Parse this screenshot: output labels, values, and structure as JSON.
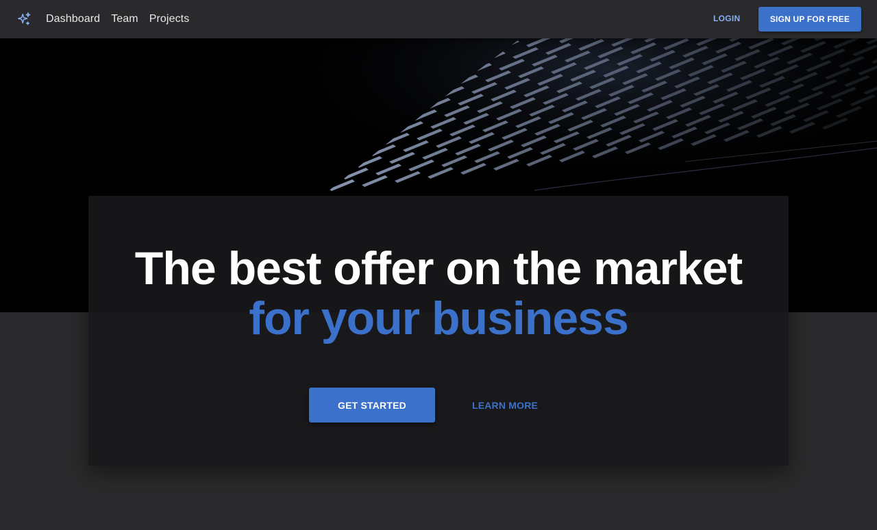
{
  "nav": {
    "brand_icon": "sparkles-icon",
    "links": [
      {
        "label": "Dashboard"
      },
      {
        "label": "Team"
      },
      {
        "label": "Projects"
      }
    ],
    "login_label": "LOGIN",
    "signup_label": "SIGN UP FOR FREE"
  },
  "hero": {
    "background_image": "dark-architecture-photo"
  },
  "main": {
    "headline": "The best offer on the market",
    "subheadline": "for your business",
    "primary_cta": "GET STARTED",
    "secondary_cta": "LEARN MORE"
  },
  "colors": {
    "accent": "#3b71ca",
    "login_text": "#8ab0f0",
    "navbar_bg": "#2a2a2c",
    "card_bg": "#18181a",
    "hero_bg": "#000000"
  }
}
